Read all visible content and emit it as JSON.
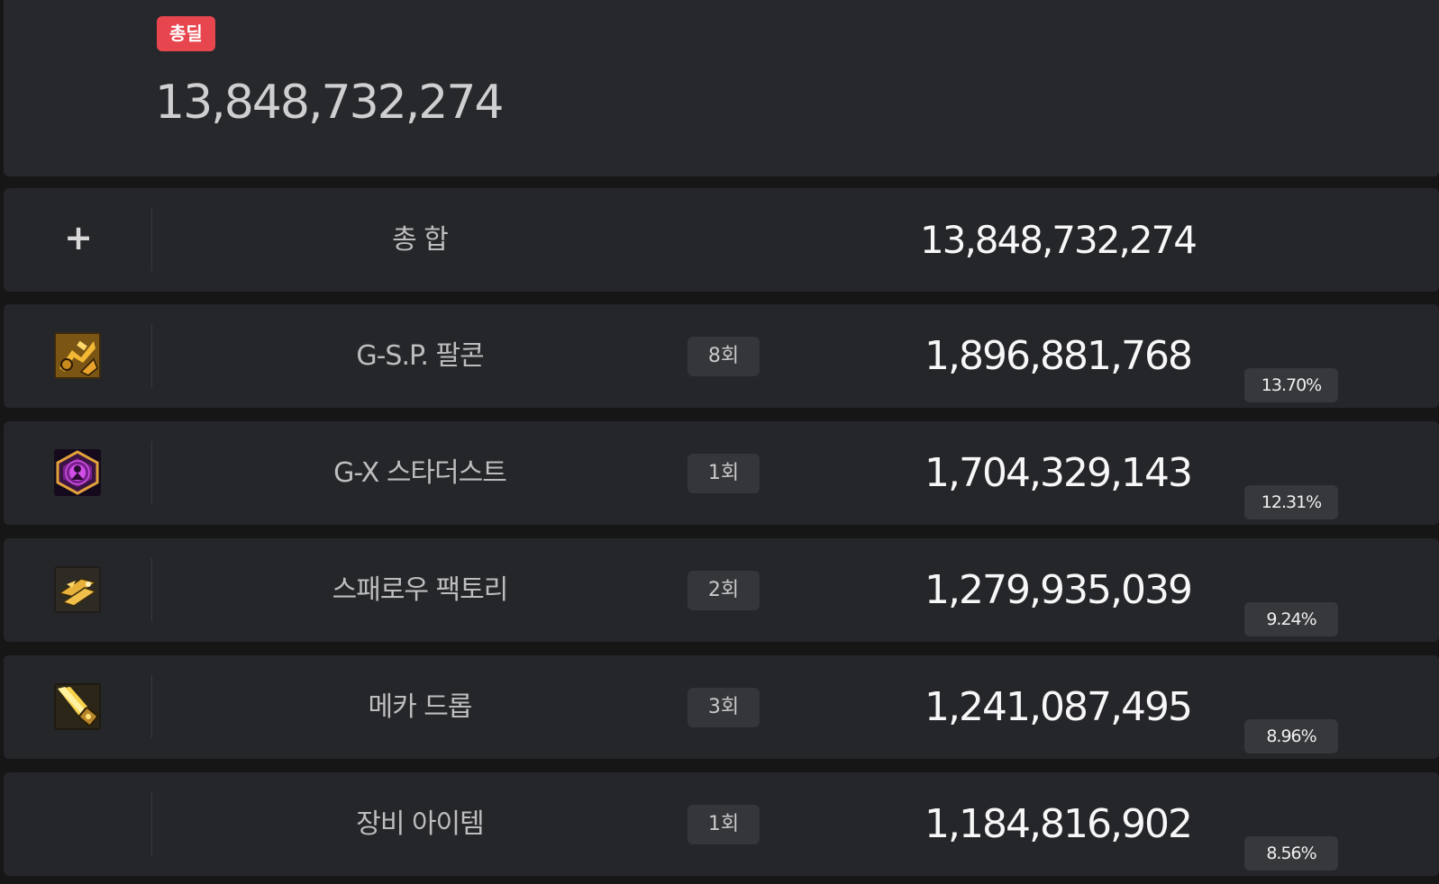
{
  "summary": {
    "badge": "총딜",
    "total": "13,848,732,274"
  },
  "total_row": {
    "plus": "+",
    "label": "총 합",
    "value": "13,848,732,274"
  },
  "rows": [
    {
      "icon": "gsp-falcon-icon",
      "name": "G-S.P. 팔콘",
      "count": "8회",
      "damage": "1,896,881,768",
      "percent": "13.70%"
    },
    {
      "icon": "gx-stardust-icon",
      "name": "G-X 스타더스트",
      "count": "1회",
      "damage": "1,704,329,143",
      "percent": "12.31%"
    },
    {
      "icon": "sparrow-factory-icon",
      "name": "스패로우 팩토리",
      "count": "2회",
      "damage": "1,279,935,039",
      "percent": "9.24%"
    },
    {
      "icon": "mecha-drop-icon",
      "name": "메카 드롭",
      "count": "3회",
      "damage": "1,241,087,495",
      "percent": "8.96%"
    },
    {
      "icon": "",
      "name": "장비 아이템",
      "count": "1회",
      "damage": "1,184,816,902",
      "percent": "8.56%"
    }
  ],
  "colors": {
    "badge": "#e8464e",
    "row_bg": "#252629",
    "page_bg": "#161617"
  }
}
